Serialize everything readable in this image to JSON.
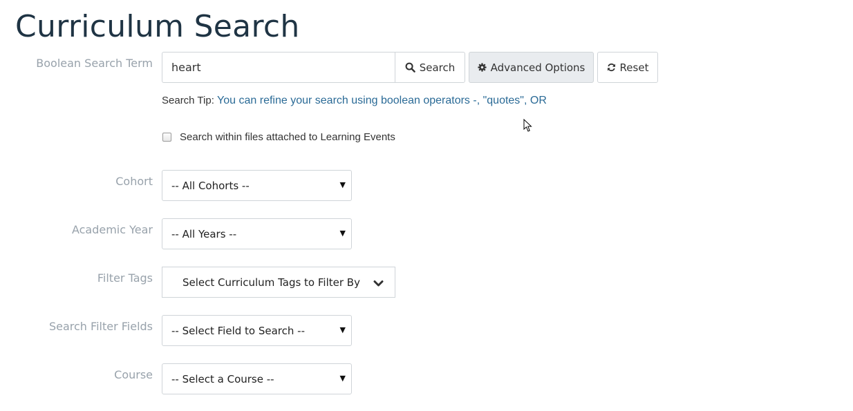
{
  "page": {
    "title": "Curriculum Search"
  },
  "search": {
    "label": "Boolean Search Term",
    "value": "heart",
    "search_button": "Search",
    "advanced_button": "Advanced Options",
    "reset_button": "Reset",
    "tip_label": "Search Tip:",
    "tip_text": "You can refine your search using boolean operators -, \"quotes\", OR",
    "files_checkbox_label": "Search within files attached to Learning Events",
    "files_checkbox_checked": false
  },
  "filters": {
    "cohort": {
      "label": "Cohort",
      "selected": "-- All Cohorts --"
    },
    "academic_year": {
      "label": "Academic Year",
      "selected": "-- All Years --"
    },
    "filter_tags": {
      "label": "Filter Tags",
      "button": "Select Curriculum Tags to Filter By"
    },
    "search_fields": {
      "label": "Search Filter Fields",
      "selected": "-- Select Field to Search --"
    },
    "course": {
      "label": "Course",
      "selected": "-- Select a Course --"
    }
  },
  "icons": {
    "search": "search-icon",
    "advanced": "gear-icon",
    "reset": "refresh-icon",
    "tags": "chevron-down-icon",
    "select_caret": "caret-down-icon"
  },
  "colors": {
    "title": "#1f3444",
    "label": "#98a2ab",
    "tip_link": "#2a6a96",
    "advanced_bg": "#e9ecef",
    "border": "#cfd4d8"
  }
}
